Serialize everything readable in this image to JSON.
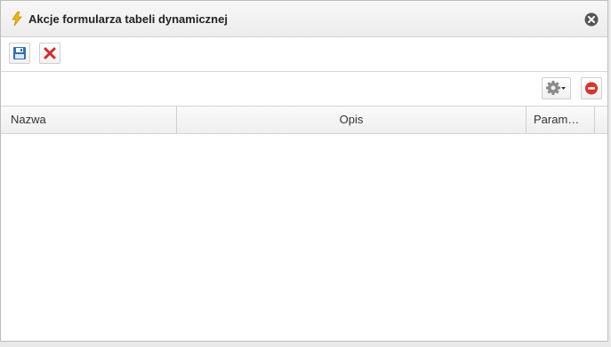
{
  "dialog": {
    "title": "Akcje formularza tabeli dynamicznej",
    "title_icon": "lightning-icon",
    "close_icon": "close-circle-icon"
  },
  "toolbar": {
    "save_icon": "floppy-disk-icon",
    "cancel_icon": "red-x-icon"
  },
  "grid_toolbar": {
    "settings_icon": "gear-icon",
    "remove_icon": "minus-circle-icon"
  },
  "grid": {
    "columns": [
      "Nazwa",
      "Opis",
      "Param…"
    ],
    "rows": []
  },
  "colors": {
    "title_icon": "#f2b705",
    "close": "#555555",
    "cancel": "#d62b2b",
    "remove": "#d9342b",
    "save": "#2e6fb4"
  }
}
